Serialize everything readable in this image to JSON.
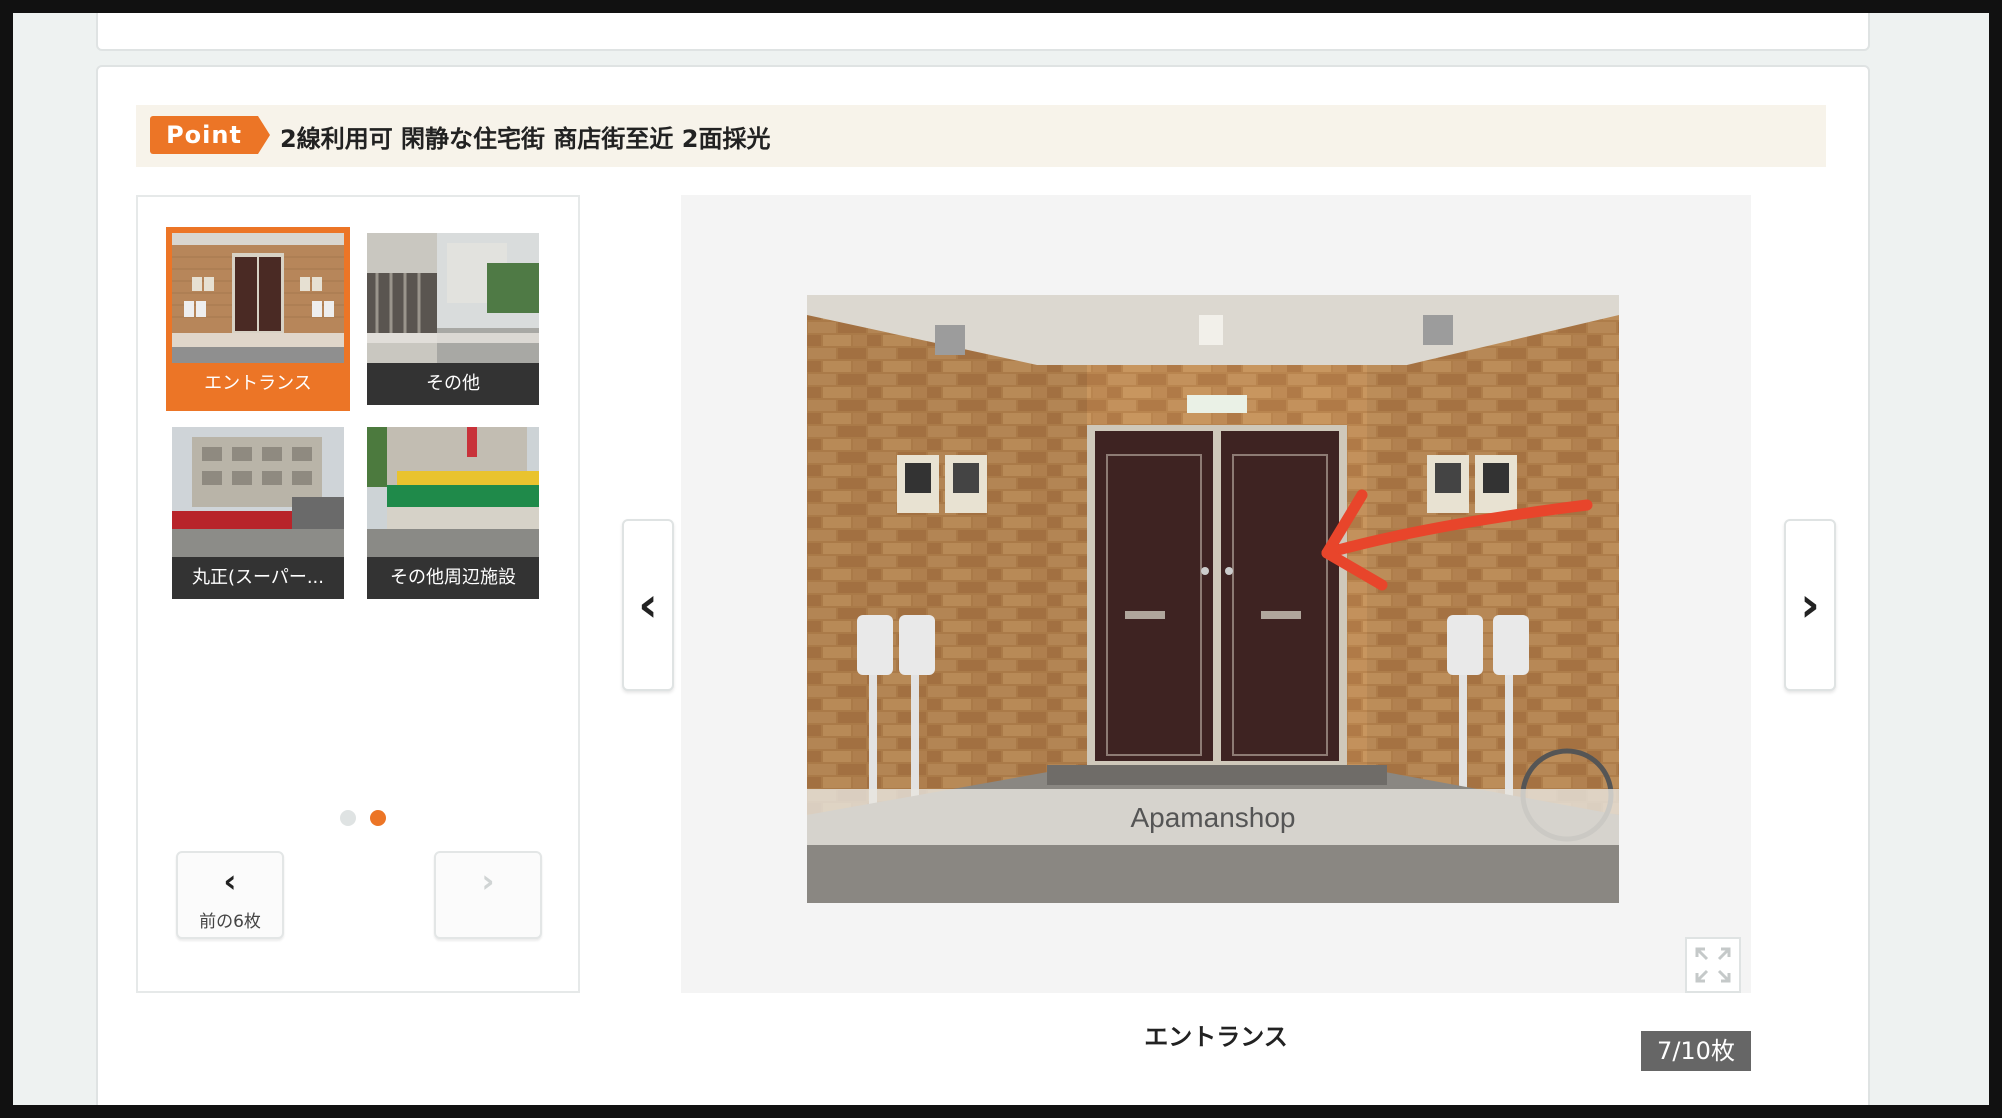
{
  "point": {
    "badge": "Point",
    "text": "2線利用可 閑静な住宅街 商店街至近 2面採光"
  },
  "thumbnails": [
    {
      "caption": "エントランス",
      "selected": true
    },
    {
      "caption": "その他",
      "selected": false
    },
    {
      "caption": "丸正(スーパー...",
      "selected": false
    },
    {
      "caption": "その他周辺施設",
      "selected": false
    }
  ],
  "pager": {
    "dots": [
      false,
      true
    ],
    "prev_label": "前の6枚",
    "prev_icon": "chevron-left-icon",
    "next_icon": "chevron-right-icon"
  },
  "viewer": {
    "watermark": "Apamanshop",
    "caption": "エントランス",
    "counter": "7/10枚",
    "prev_icon": "chevron-left-icon",
    "next_icon": "chevron-right-icon",
    "expand_icon": "expand-icon"
  },
  "colors": {
    "accent": "#ec7526",
    "point_bar": "#f7f3ea",
    "counter_bg": "#666666"
  }
}
